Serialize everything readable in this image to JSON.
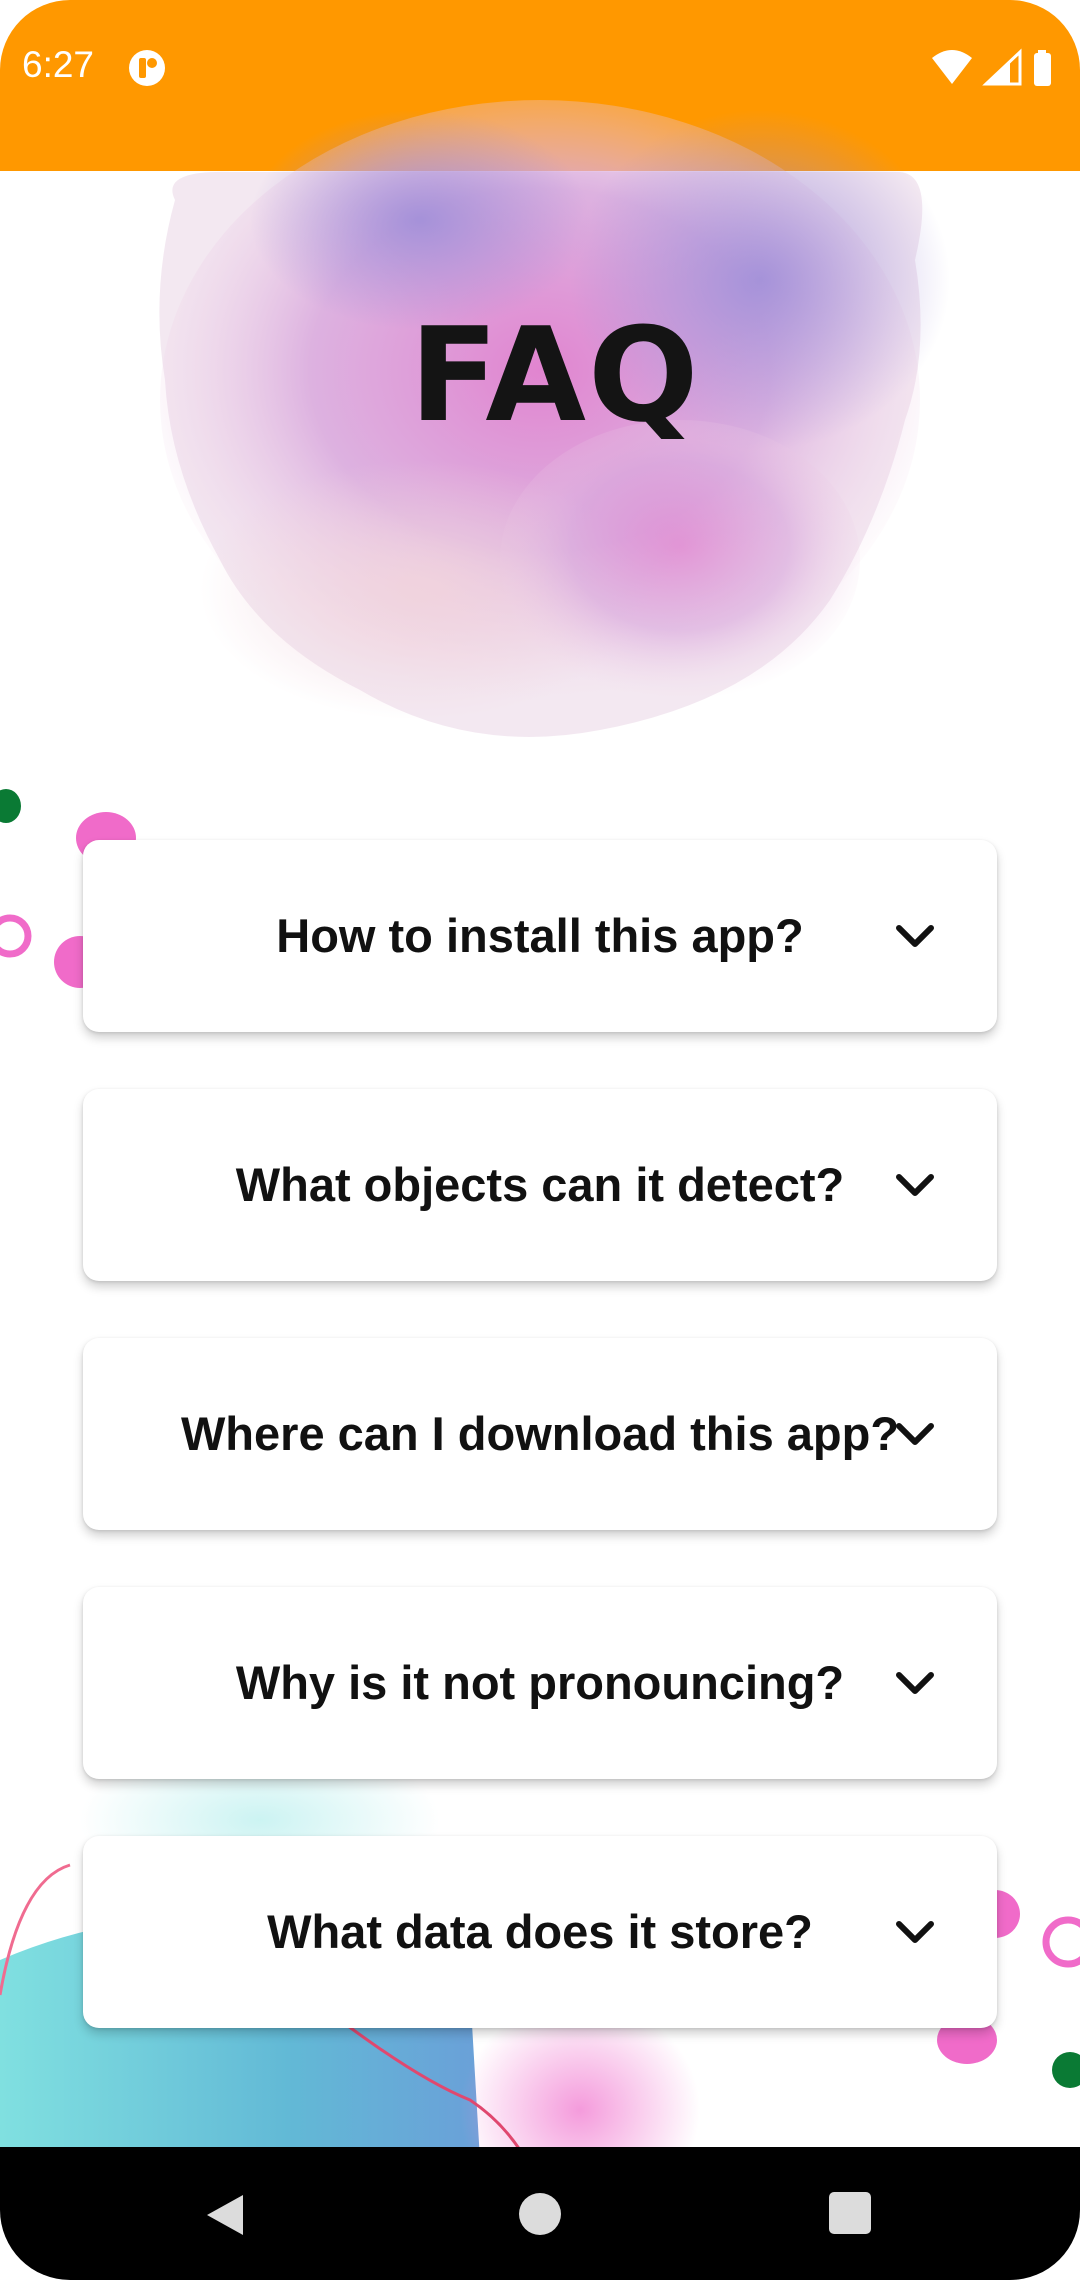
{
  "status_bar": {
    "time": "6:27",
    "app_icon": "notification-app-icon",
    "wifi_icon": "wifi-icon",
    "signal_icon": "cell-signal-icon",
    "battery_icon": "battery-icon"
  },
  "header": {
    "title": "FAQ"
  },
  "faq": {
    "items": [
      {
        "question": "How to install this app?"
      },
      {
        "question": "What objects can it detect?"
      },
      {
        "question": "Where can I download this app?"
      },
      {
        "question": "Why is it not pronouncing?"
      },
      {
        "question": "What data does it store?"
      }
    ]
  },
  "colors": {
    "status_bar": "#ff9800",
    "accent_pink": "#f06bc9",
    "accent_green": "#0a7a34",
    "accent_teal": "#7fdcdc",
    "text": "#111111"
  },
  "navigation": {
    "back_icon": "back-triangle-icon",
    "home_icon": "home-circle-icon",
    "recents_icon": "recents-square-icon"
  }
}
